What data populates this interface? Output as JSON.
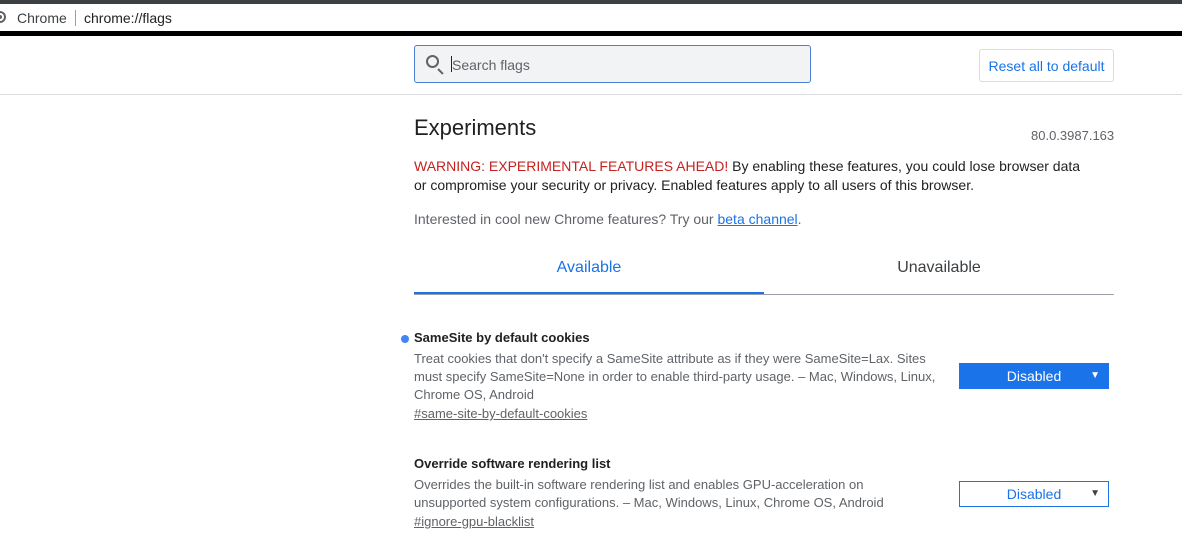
{
  "browser": {
    "chrome_label": "Chrome",
    "url": "chrome://flags"
  },
  "search": {
    "placeholder": "Search flags"
  },
  "toolbar": {
    "reset_label": "Reset all to default"
  },
  "page": {
    "title": "Experiments",
    "version": "80.0.3987.163",
    "warning_prefix": "WARNING: EXPERIMENTAL FEATURES AHEAD!",
    "warning_text": " By enabling these features, you could lose browser data or compromise your security or privacy. Enabled features apply to all users of this browser.",
    "interested_text": "Interested in cool new Chrome features? Try our ",
    "beta_link": "beta channel",
    "interested_suffix": "."
  },
  "tabs": [
    {
      "label": "Available",
      "active": true
    },
    {
      "label": "Unavailable",
      "active": false
    }
  ],
  "experiments": [
    {
      "title": "SameSite by default cookies",
      "description": "Treat cookies that don't specify a SameSite attribute as if they were SameSite=Lax. Sites must specify SameSite=None in order to enable third-party usage. – Mac, Windows, Linux, Chrome OS, Android",
      "link": "#same-site-by-default-cookies",
      "value": "Disabled",
      "modified": true
    },
    {
      "title": "Override software rendering list",
      "description": "Overrides the built-in software rendering list and enables GPU-acceleration on unsupported system configurations. – Mac, Windows, Linux, Chrome OS, Android",
      "link": "#ignore-gpu-blacklist",
      "value": "Disabled",
      "modified": false
    }
  ],
  "colors": {
    "accent": "#1a73e8",
    "warning": "#c5221f",
    "modified_dot": "#4285f4"
  }
}
